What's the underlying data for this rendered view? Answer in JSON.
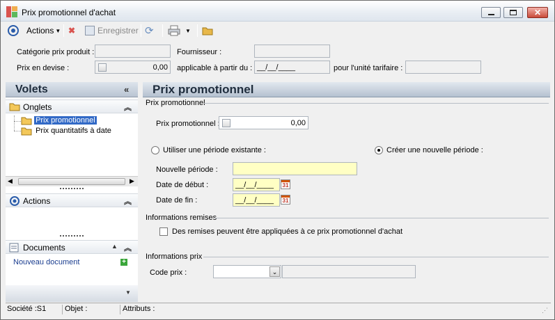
{
  "window": {
    "title": "Prix promotionnel d'achat"
  },
  "toolbar": {
    "actions": "Actions",
    "enregistrer": "Enregistrer"
  },
  "header_fields": {
    "categorie_label": "Catégorie prix produit :",
    "fournisseur_label": "Fournisseur :",
    "prix_devise_label": "Prix en devise :",
    "prix_devise_value": "0,00",
    "applicable_label": "applicable à partir du :",
    "applicable_value": "__/__/____",
    "unite_label": "pour l'unité tarifaire :"
  },
  "sidebar": {
    "title": "Volets",
    "onglets_title": "Onglets",
    "tabs": [
      "Prix promotionnel",
      "Prix quantitatifs à date"
    ],
    "actions_title": "Actions",
    "documents_title": "Documents",
    "new_document": "Nouveau document"
  },
  "main": {
    "title": "Prix promotionnel",
    "group_prix": "Prix promotionnel",
    "prix_label": "Prix promotionnel :",
    "prix_value": "0,00",
    "radio_existing": "Utiliser une période existante :",
    "radio_new": "Créer une nouvelle période :",
    "nouvelle_periode_label": "Nouvelle période :",
    "date_debut_label": "Date de début :",
    "date_debut_value": "__/__/____",
    "date_fin_label": "Date de fin :",
    "date_fin_value": "__/__/____",
    "group_remises": "Informations remises",
    "remises_checkbox": "Des remises peuvent être appliquées à ce prix promotionnel d'achat",
    "group_prix_info": "Informations prix",
    "code_prix_label": "Code prix :",
    "calendar_day": "31"
  },
  "status": {
    "societe": "Société :S1",
    "objet": "Objet :",
    "attributs": "Attributs :"
  }
}
